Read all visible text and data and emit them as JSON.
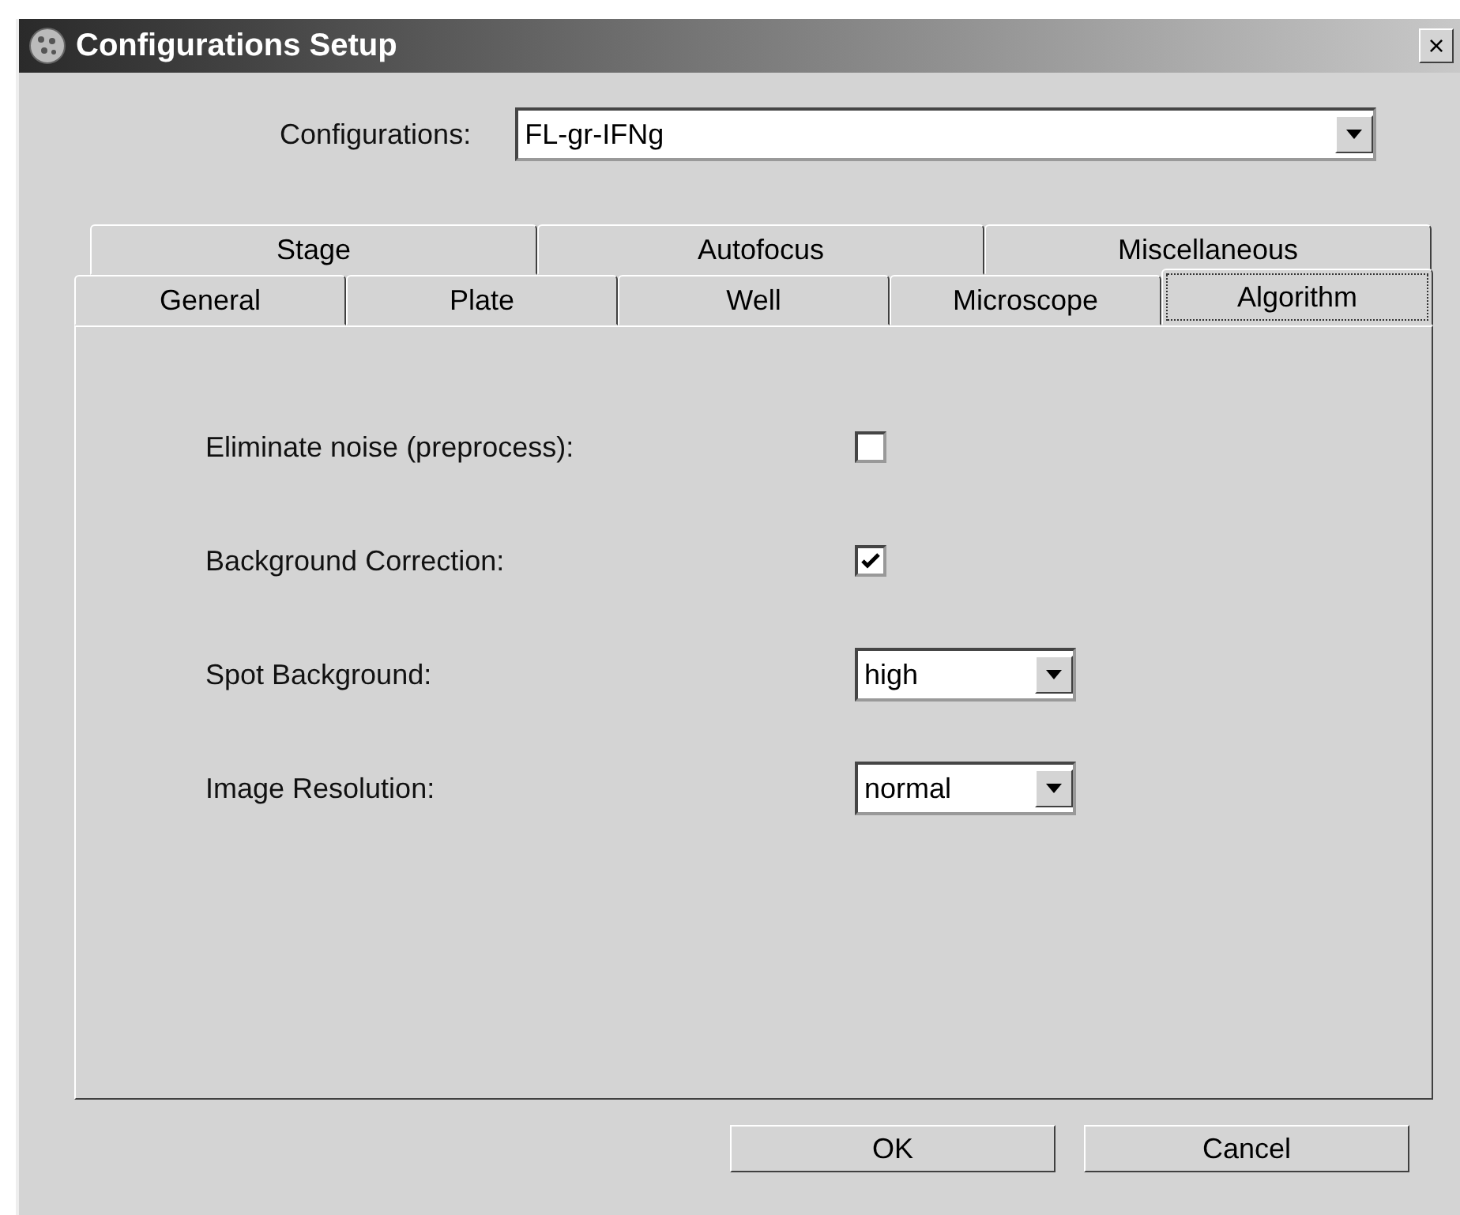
{
  "window": {
    "title": "Configurations Setup",
    "close": "×"
  },
  "configurations": {
    "label": "Configurations:",
    "value": "FL-gr-IFNg"
  },
  "tab_rows": [
    {
      "tabs": [
        {
          "label": "Stage",
          "selected": false
        },
        {
          "label": "Autofocus",
          "selected": false
        },
        {
          "label": "Miscellaneous",
          "selected": false
        }
      ]
    },
    {
      "tabs": [
        {
          "label": "General",
          "selected": false
        },
        {
          "label": "Plate",
          "selected": false
        },
        {
          "label": "Well",
          "selected": false
        },
        {
          "label": "Microscope",
          "selected": false
        },
        {
          "label": "Algorithm",
          "selected": true
        }
      ]
    }
  ],
  "settings": [
    {
      "kind": "checkbox",
      "label": "Eliminate noise (preprocess):",
      "checked": false
    },
    {
      "kind": "checkbox",
      "label": "Background Correction:",
      "checked": true
    },
    {
      "kind": "dropdown",
      "label": "Spot Background:",
      "value": "high"
    },
    {
      "kind": "dropdown",
      "label": "Image Resolution:",
      "value": "normal"
    }
  ],
  "buttons": [
    "OK",
    "Cancel"
  ]
}
